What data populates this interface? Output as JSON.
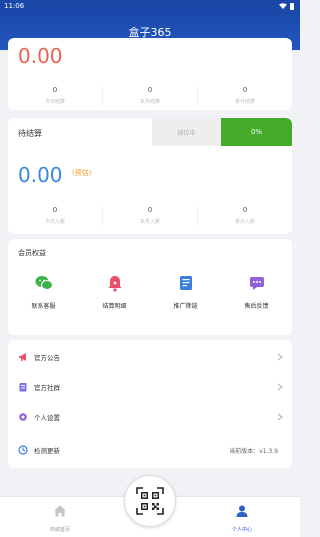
{
  "status_bar": {
    "time": "11:06"
  },
  "header": {
    "title": "盒子365"
  },
  "earnings_card": {
    "amount": "0.00",
    "stats": [
      {
        "value": "0",
        "label": "今日结算"
      },
      {
        "value": "0",
        "label": "本月结算"
      },
      {
        "value": "0",
        "label": "累计结算"
      }
    ]
  },
  "pending_card": {
    "title": "待结算",
    "tab_pending": "排位中",
    "tab_progress": "0%",
    "amount": "0.00",
    "estimate": "(预估)",
    "stats": [
      {
        "value": "0",
        "label": "今日入账"
      },
      {
        "value": "0",
        "label": "本月入账"
      },
      {
        "value": "0",
        "label": "累计入账"
      }
    ]
  },
  "benefits_card": {
    "title": "会员权益",
    "items": [
      {
        "label": "联系客服",
        "icon": "wechat-icon",
        "color": "#3bb34a"
      },
      {
        "label": "结算明细",
        "icon": "bell-icon",
        "color": "#e8506a"
      },
      {
        "label": "推广降链",
        "icon": "document-icon",
        "color": "#3a7fe0"
      },
      {
        "label": "售后反馈",
        "icon": "message-icon",
        "color": "#8e62d9"
      }
    ]
  },
  "menu": {
    "items": [
      {
        "label": "官方公告",
        "icon": "megaphone-icon",
        "color": "#e8506a",
        "value": ""
      },
      {
        "label": "官方社群",
        "icon": "group-icon",
        "color": "#7a6fe0",
        "value": ""
      },
      {
        "label": "个人设置",
        "icon": "gear-icon",
        "color": "#8e62d9",
        "value": ""
      },
      {
        "label": "检测更新",
        "icon": "refresh-icon",
        "color": "#3a7fe0",
        "value": "当前版本：v1.3.9"
      }
    ]
  },
  "bottom_nav": {
    "home_label": "商城首页",
    "me_label": "个人中心",
    "active_color": "#2e62c8"
  },
  "colors": {
    "header_blue": "#1b48aa",
    "earnings_red": "#e9634f",
    "pending_blue": "#3b87e0",
    "progress_green": "#43aa2a",
    "estimate_orange": "#f29b2e"
  }
}
